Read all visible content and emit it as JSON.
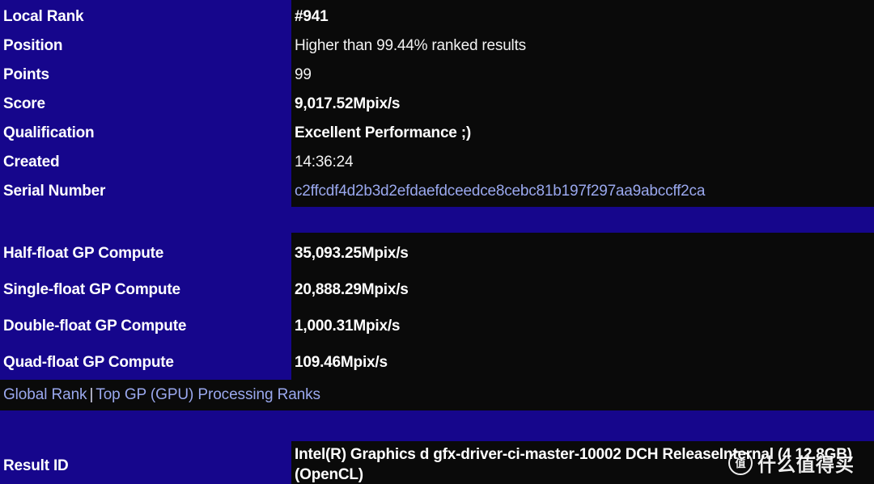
{
  "colors": {
    "panel_blue": "#16068C",
    "panel_black": "#0a0a0a",
    "text_white": "#ffffff",
    "link_purple": "#9aa8ee"
  },
  "summary_rows": [
    {
      "label": "Local Rank",
      "value": "#941",
      "style": "bold"
    },
    {
      "label": "Position",
      "value": "Higher than 99.44% ranked results",
      "style": "normal"
    },
    {
      "label": "Points",
      "value": "99",
      "style": "normal"
    },
    {
      "label": "Score",
      "value": "9,017.52Mpix/s",
      "style": "bold"
    },
    {
      "label": "Qualification",
      "value": "Excellent Performance ;)",
      "style": "bold"
    },
    {
      "label": "Created",
      "value": "14:36:24",
      "style": "normal"
    },
    {
      "label": "Serial Number",
      "value": "c2ffcdf4d2b3d2efdaefdceedce8cebc81b197f297aa9abccff2ca",
      "style": "link"
    }
  ],
  "compute_rows": [
    {
      "label": "Half-float GP Compute",
      "value": "35,093.25Mpix/s"
    },
    {
      "label": "Single-float GP Compute",
      "value": "20,888.29Mpix/s"
    },
    {
      "label": "Double-float GP Compute",
      "value": "1,000.31Mpix/s"
    },
    {
      "label": "Quad-float GP Compute",
      "value": "109.46Mpix/s"
    }
  ],
  "links": {
    "global_rank": "Global Rank",
    "separator": "|",
    "top_gp": "Top GP (GPU) Processing Ranks"
  },
  "result": {
    "label": "Result ID",
    "value": "Intel(R) Graphics d gfx-driver-ci-master-10002 DCH ReleaseInternal (4 12.8GB) (OpenCL)"
  },
  "watermark": {
    "logo_glyph": "值",
    "text": "什么值得买"
  }
}
